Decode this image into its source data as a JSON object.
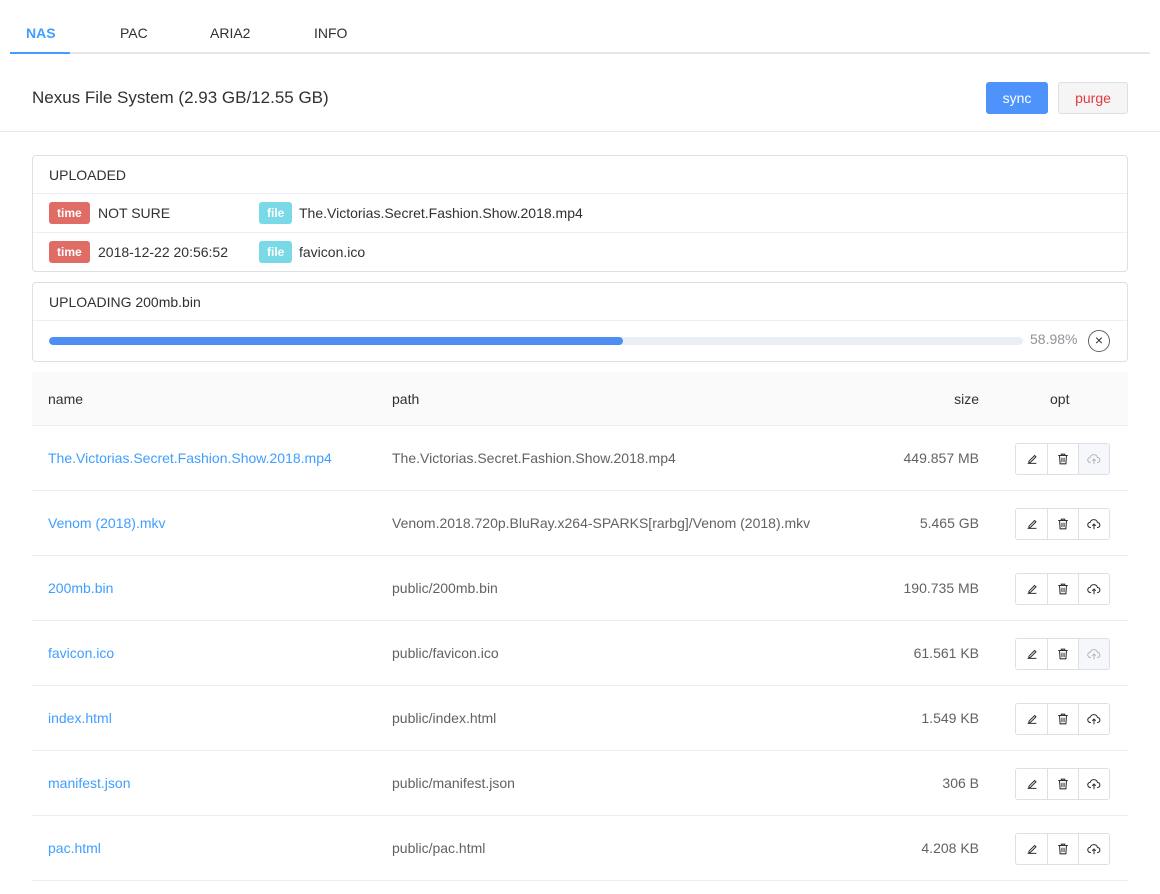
{
  "tabs": [
    {
      "label": "NAS",
      "active": true
    },
    {
      "label": "PAC",
      "active": false
    },
    {
      "label": "ARIA2",
      "active": false
    },
    {
      "label": "INFO",
      "active": false
    }
  ],
  "header": {
    "title": "Nexus File System (2.93 GB/12.55 GB)",
    "sync_label": "sync",
    "purge_label": "purge"
  },
  "uploaded": {
    "title": "UPLOADED",
    "time_tag": "time",
    "file_tag": "file",
    "items": [
      {
        "time": "NOT SURE",
        "file": "The.Victorias.Secret.Fashion.Show.2018.mp4"
      },
      {
        "time": "2018-12-22 20:56:52",
        "file": "favicon.ico"
      }
    ]
  },
  "uploading": {
    "title": "UPLOADING 200mb.bin",
    "progress": 58.98,
    "progress_text": "58.98%",
    "cancel_symbol": "×"
  },
  "table": {
    "columns": {
      "name": "name",
      "path": "path",
      "size": "size",
      "opt": "opt"
    },
    "rows": [
      {
        "name": "The.Victorias.Secret.Fashion.Show.2018.mp4",
        "path": "The.Victorias.Secret.Fashion.Show.2018.mp4",
        "size": "449.857 MB",
        "upload_enabled": false
      },
      {
        "name": "Venom (2018).mkv",
        "path": "Venom.2018.720p.BluRay.x264-SPARKS[rarbg]/Venom (2018).mkv",
        "size": "5.465 GB",
        "upload_enabled": true
      },
      {
        "name": "200mb.bin",
        "path": "public/200mb.bin",
        "size": "190.735 MB",
        "upload_enabled": true
      },
      {
        "name": "favicon.ico",
        "path": "public/favicon.ico",
        "size": "61.561 KB",
        "upload_enabled": false
      },
      {
        "name": "index.html",
        "path": "public/index.html",
        "size": "1.549 KB",
        "upload_enabled": true
      },
      {
        "name": "manifest.json",
        "path": "public/manifest.json",
        "size": "306 B",
        "upload_enabled": true
      },
      {
        "name": "pac.html",
        "path": "public/pac.html",
        "size": "4.208 KB",
        "upload_enabled": true
      }
    ]
  },
  "icons": {
    "edit": "edit-icon",
    "delete": "trash-icon",
    "upload": "cloud-upload-icon"
  },
  "colors": {
    "accent": "#409eff",
    "time_tag": "#e06c66",
    "file_tag": "#79d9e6",
    "danger": "#e0393e"
  }
}
